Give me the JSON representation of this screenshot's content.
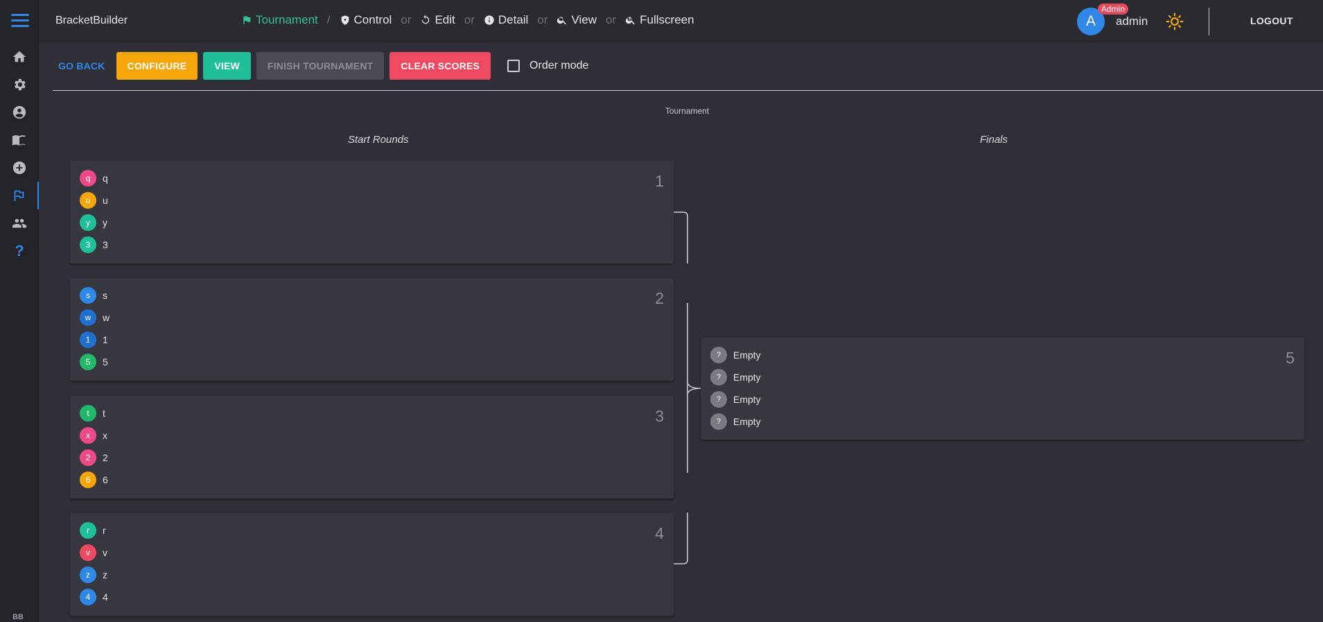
{
  "app": {
    "brand": "BracketBuilder",
    "sidebar_footer": "BB"
  },
  "sidebar": {
    "items": [
      {
        "name": "home",
        "icon": "home-icon"
      },
      {
        "name": "settings",
        "icon": "gear-icon"
      },
      {
        "name": "profile",
        "icon": "account-circle-icon"
      },
      {
        "name": "docs",
        "icon": "book-icon"
      },
      {
        "name": "create",
        "icon": "plus-circle-icon"
      },
      {
        "name": "tournament",
        "icon": "flag-icon",
        "active": true
      },
      {
        "name": "users",
        "icon": "people-icon"
      },
      {
        "name": "help",
        "icon": "help-icon",
        "glyph": "?"
      }
    ]
  },
  "breadcrumb": {
    "current": "Tournament",
    "slash": "/",
    "or": "or",
    "links": [
      "Control",
      "Edit",
      "Detail",
      "View",
      "Fullscreen"
    ]
  },
  "user": {
    "initial": "A",
    "badge": "Admin",
    "name": "admin",
    "logout": "LOGOUT"
  },
  "toolbar": {
    "go_back": "GO BACK",
    "configure": "CONFIGURE",
    "view": "VIEW",
    "finish": "FINISH TOURNAMENT",
    "clear": "CLEAR SCORES",
    "order_mode": "Order mode"
  },
  "tournament": {
    "title": "Tournament",
    "columns": [
      "Start Rounds",
      "Finals"
    ],
    "matches": [
      {
        "number": "1",
        "players": [
          {
            "badge": "q",
            "name": "q",
            "color": "#ee4b86"
          },
          {
            "badge": "u",
            "name": "u",
            "color": "#f6a609"
          },
          {
            "badge": "y",
            "name": "y",
            "color": "#1fbf9a"
          },
          {
            "badge": "3",
            "name": "3",
            "color": "#1fbf9a"
          }
        ]
      },
      {
        "number": "2",
        "players": [
          {
            "badge": "s",
            "name": "s",
            "color": "#2f88e8"
          },
          {
            "badge": "w",
            "name": "w",
            "color": "#1f6fd1"
          },
          {
            "badge": "1",
            "name": "1",
            "color": "#1f6fd1"
          },
          {
            "badge": "5",
            "name": "5",
            "color": "#22b86a"
          }
        ]
      },
      {
        "number": "3",
        "players": [
          {
            "badge": "t",
            "name": "t",
            "color": "#22b86a"
          },
          {
            "badge": "x",
            "name": "x",
            "color": "#ee4b86"
          },
          {
            "badge": "2",
            "name": "2",
            "color": "#ee4b86"
          },
          {
            "badge": "6",
            "name": "6",
            "color": "#f6a609"
          }
        ]
      },
      {
        "number": "4",
        "players": [
          {
            "badge": "r",
            "name": "r",
            "color": "#1fbf9a"
          },
          {
            "badge": "v",
            "name": "v",
            "color": "#ef4a62"
          },
          {
            "badge": "z",
            "name": "z",
            "color": "#2f88e8"
          },
          {
            "badge": "4",
            "name": "4",
            "color": "#2f88e8"
          }
        ]
      },
      {
        "number": "5",
        "players": [
          {
            "badge": "?",
            "name": "Empty",
            "color": "#7a7a82"
          },
          {
            "badge": "?",
            "name": "Empty",
            "color": "#7a7a82"
          },
          {
            "badge": "?",
            "name": "Empty",
            "color": "#7a7a82"
          },
          {
            "badge": "?",
            "name": "Empty",
            "color": "#7a7a82"
          }
        ]
      }
    ]
  }
}
